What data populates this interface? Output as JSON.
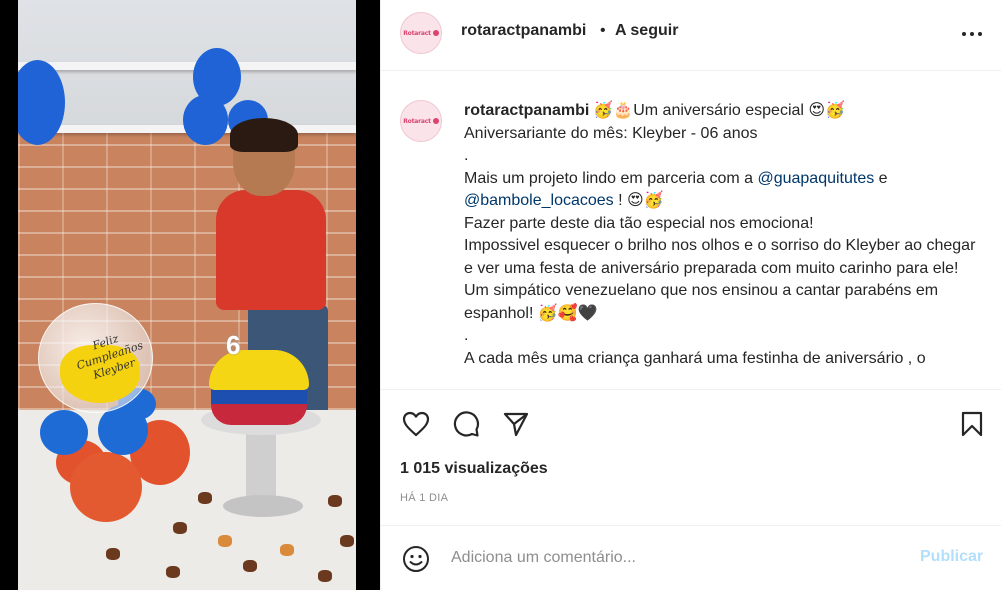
{
  "header": {
    "username": "rotaractpanambi",
    "separator": "•",
    "follow_label": "A seguir",
    "avatar_logo": "Rotaract"
  },
  "caption": {
    "username": "rotaractpanambi",
    "lines": [
      "🥳🎂Um aniversário especial 😍🥳",
      "Aniversariante do mês: Kleyber - 06 anos",
      ".",
      "Mais um projeto lindo em parceria com a ",
      "@guapaquitutes",
      " e",
      "@bambole_locacoes",
      " ! 😍🥳",
      "Fazer parte deste dia tão especial nos emociona!",
      "Impossivel esquecer o brilho nos olhos e o sorriso do Kleyber ao chegar e ver uma festa de aniversário preparada com muito carinho para ele!",
      "Um simpático venezuelano que nos ensinou a cantar parabéns em espanhol! 🥳🥰🖤",
      ".",
      "A cada mês uma criança ganhará uma festinha de aniversário , o"
    ]
  },
  "media": {
    "balloon_text_1": "Feliz",
    "balloon_text_2": "Cumpleaños",
    "balloon_text_3": "Kleyber",
    "candle_number": "6"
  },
  "actions": {
    "like_icon": "heart-icon",
    "comment_icon": "comment-icon",
    "share_icon": "paper-plane-icon",
    "save_icon": "bookmark-icon"
  },
  "views": "1 015 visualizações",
  "time_ago": "HÁ 1 DIA",
  "comment_bar": {
    "placeholder": "Adiciona um comentário...",
    "post_label": "Publicar"
  }
}
